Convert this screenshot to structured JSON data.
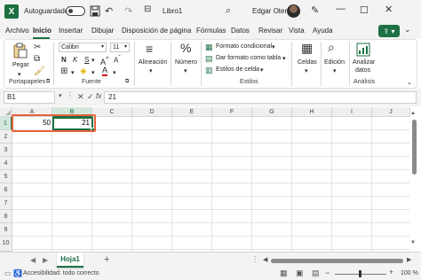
{
  "titlebar": {
    "autosave_label": "Autoguardado",
    "filename": "Libro1",
    "user": "Edgar Otero",
    "undo_icon": "undo-icon",
    "redo_icon": "redo-icon"
  },
  "tabs": [
    "Archivo",
    "Inicio",
    "Insertar",
    "Dibujar",
    "Disposición de página",
    "Fórmulas",
    "Datos",
    "Revisar",
    "Vista",
    "Ayuda"
  ],
  "active_tab": "Inicio",
  "ribbon": {
    "paste_label": "Pegar",
    "clipboard_group": "Portapapeles",
    "font_name": "Calibri",
    "font_size": "11",
    "bold": "N",
    "italic": "K",
    "underline": "S",
    "font_group": "Fuente",
    "alignment_label": "Alineación",
    "number_label": "Número",
    "conditional_format": "Formato condicional",
    "format_as_table": "Dar formato como tabla",
    "cell_styles": "Estilos de celda",
    "styles_group": "Estilos",
    "cells_label": "Celdas",
    "editing_label": "Edición",
    "analyze_label_1": "Analizar",
    "analyze_label_2": "datos",
    "analysis_group": "Análisis"
  },
  "formula_bar": {
    "name_box": "B1",
    "fx": "fx",
    "content": "21"
  },
  "grid": {
    "columns": [
      "A",
      "B",
      "C",
      "D",
      "E",
      "F",
      "G",
      "H",
      "I",
      "J"
    ],
    "rows": [
      "1",
      "2",
      "3",
      "4",
      "5",
      "6",
      "7",
      "8",
      "9",
      "10"
    ],
    "cells": {
      "A1": "50",
      "B1": "21"
    },
    "selected_cell": "B1"
  },
  "sheets": {
    "tabs": [
      "Hoja1"
    ],
    "active": "Hoja1",
    "add_label": "+"
  },
  "statusbar": {
    "accessibility": "Accesibilidad: todo correcto",
    "zoom": "100 %"
  },
  "colors": {
    "accent": "#1d6f42",
    "highlight": "#e8643c",
    "chrome": "#f3f3f3"
  }
}
